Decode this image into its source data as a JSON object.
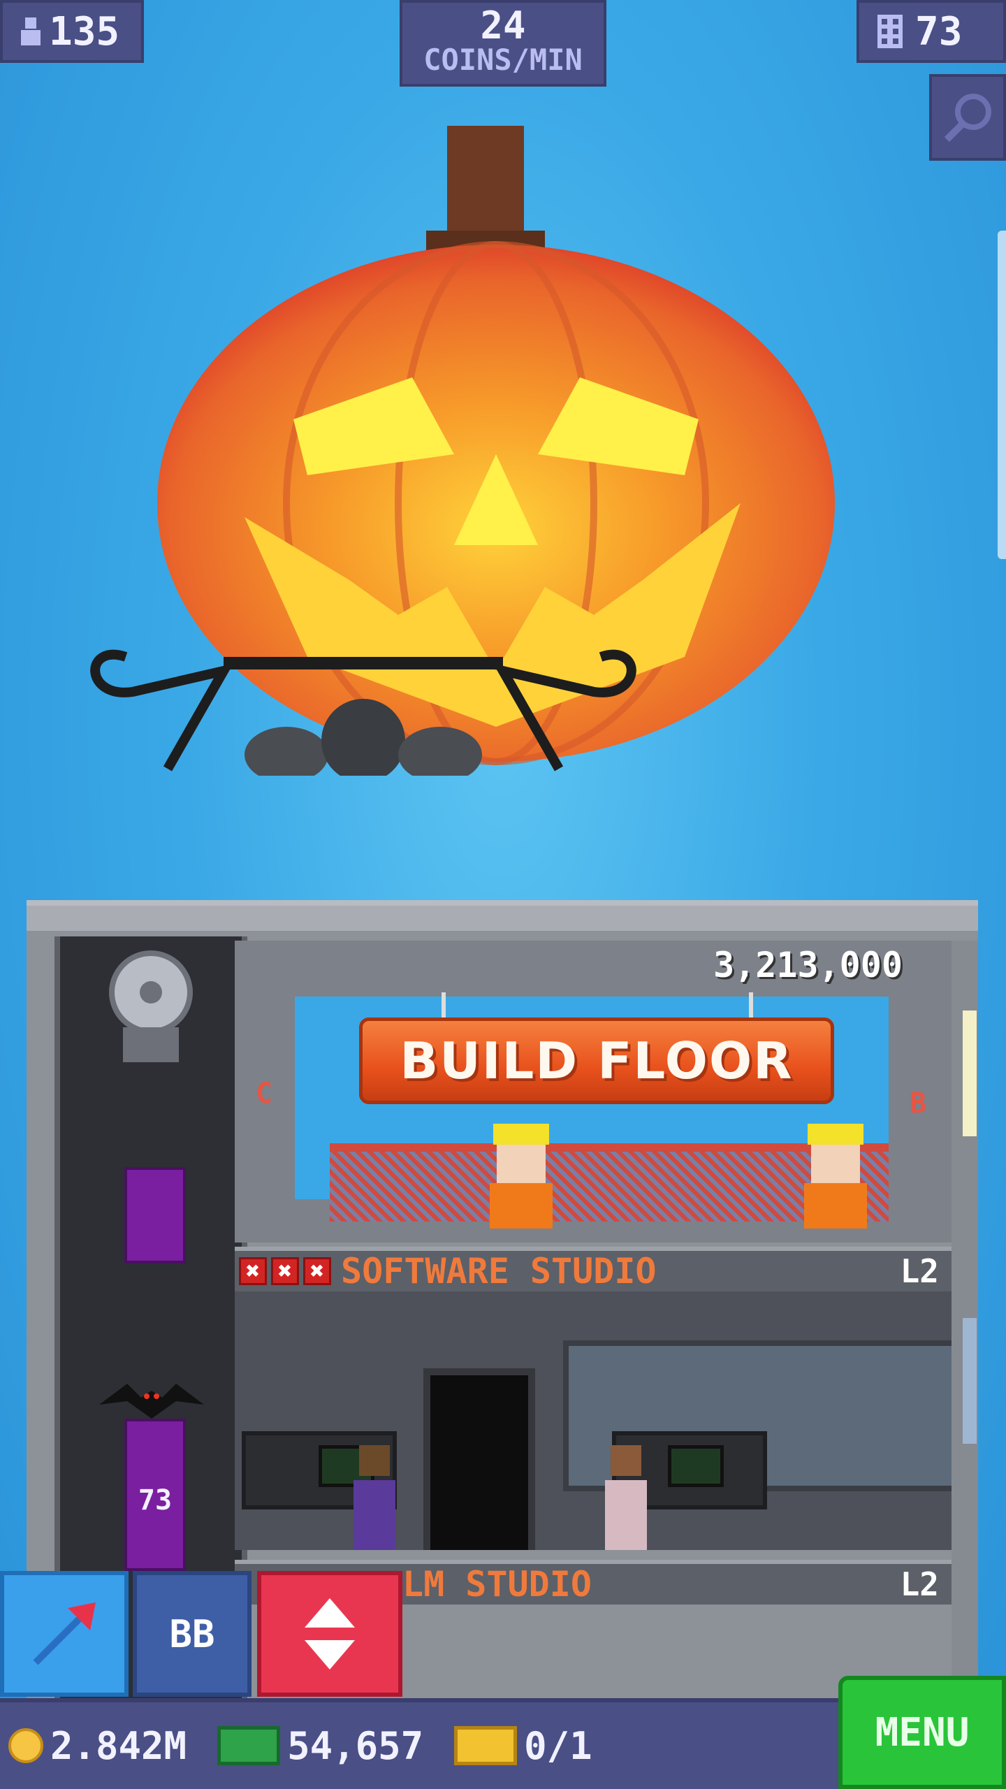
{
  "top_bar": {
    "population": "135",
    "coins_per_min_value": "24",
    "coins_per_min_unit": "COINS/MIN",
    "floor_count": "73"
  },
  "build": {
    "cost": "3,213,000",
    "button_label": "BUILD FLOOR",
    "left_marker": "C",
    "right_marker": "B"
  },
  "floors": [
    {
      "name": "SOFTWARE STUDIO",
      "level": "L2"
    },
    {
      "name": "LM STUDIO",
      "level": "L2"
    }
  ],
  "elevator": {
    "label": "73"
  },
  "buttons": {
    "bb_label": "BB",
    "menu_label": "MENU"
  },
  "status": {
    "coins": "2.842M",
    "bux": "54,657",
    "tickets": "0/1"
  },
  "colors": {
    "sky": "#3aa8e6",
    "panel": "#4a4f86",
    "build_button": "#e8511c",
    "menu_button": "#29c43a",
    "elevator_car": "#7a1fa0"
  },
  "icons": {
    "population": "person-icon",
    "floors": "building-icon",
    "zoom": "magnifier-icon",
    "arrow_button": "red-arrow-icon",
    "elevator_button": "up-down-arrows-icon",
    "coin": "coin-icon",
    "bux": "cash-icon",
    "ticket": "ticket-icon"
  }
}
